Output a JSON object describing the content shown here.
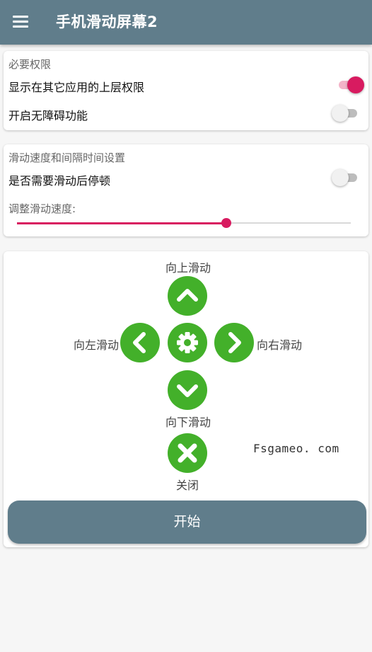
{
  "app": {
    "title": "手机滑动屏幕2",
    "menu_icon": "hamburger-menu-icon"
  },
  "colors": {
    "appbar": "#607d8b",
    "accent": "#d81b60",
    "arrow_button": "#43b02a"
  },
  "permissions": {
    "title": "必要权限",
    "overlay_label": "显示在其它应用的上层权限",
    "overlay_on": true,
    "accessibility_label": "开启无障碍功能",
    "accessibility_on": false
  },
  "speed_settings": {
    "title": "滑动速度和间隔时间设置",
    "pause_label": "是否需要滑动后停顿",
    "pause_on": false,
    "speed_label": "调整滑动速度:",
    "speed_fraction": 0.628
  },
  "controls": {
    "up_label": "向上滑动",
    "left_label": "向左滑动",
    "right_label": "向右滑动",
    "down_label": "向下滑动",
    "close_label": "关闭",
    "center_icon": "gear-icon",
    "watermark": "Fsgameo. com",
    "start_label": "开始"
  }
}
